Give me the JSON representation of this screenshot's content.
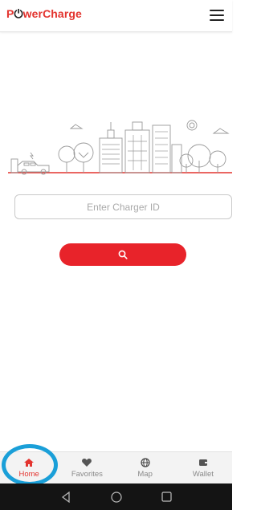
{
  "header": {
    "logo_prefix": "P",
    "logo_glyph": "⏻",
    "logo_suffix": "werCharge",
    "menu_icon": "hamburger-menu-icon"
  },
  "charger_search": {
    "placeholder": "Enter Charger ID",
    "value": "",
    "button_icon": "search-icon"
  },
  "bottom_nav": {
    "items": [
      {
        "label": "Home",
        "icon": "home-icon",
        "active": true
      },
      {
        "label": "Favorites",
        "icon": "heart-icon",
        "active": false
      },
      {
        "label": "Map",
        "icon": "globe-icon",
        "active": false
      },
      {
        "label": "Wallet",
        "icon": "wallet-icon",
        "active": false
      }
    ]
  },
  "system_nav": {
    "buttons": [
      "back-icon",
      "home-circle-icon",
      "recents-icon"
    ]
  },
  "colors": {
    "brand_red": "#e3342f",
    "button_red": "#e8232a",
    "highlight_blue": "#1a9fd8",
    "nav_inactive": "#8a8a8a"
  }
}
